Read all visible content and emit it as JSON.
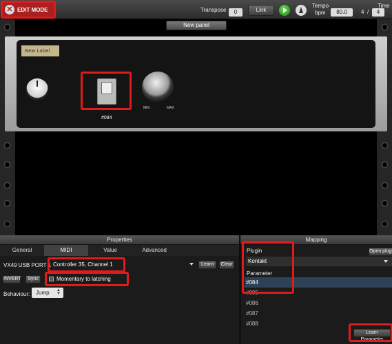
{
  "topbar": {
    "edit_mode": "EDIT MODE",
    "transpose_label": "Transpose",
    "transpose_value": "0",
    "link_label": "Link",
    "tempo_label": "Tempo",
    "bpm_label": "bpm",
    "tempo_value": "80.0",
    "time_label": "Time",
    "time_numerator": "4",
    "time_separator": "/",
    "time_denominator": "4"
  },
  "rack": {
    "new_panel_label": "New panel",
    "panel_label": "New Label",
    "switch_tag": "#084",
    "knob_min": "MIN",
    "knob_max": "MAX"
  },
  "properties": {
    "title": "Properties",
    "tabs": [
      "General",
      "MIDI",
      "Value",
      "Advanced"
    ],
    "active_tab": "MIDI",
    "port": "VX49 USB PORT 1",
    "controller": "Controller 35, Channel 1",
    "learn_label": "Learn",
    "clear_label": "Clear",
    "invert_label": "INVERT",
    "sync_label": "Sync",
    "momentary_label": "Momentary to latching",
    "behaviour_label": "Behaviour:",
    "behaviour_value": "Jump"
  },
  "mapping": {
    "title": "Mapping",
    "plugin_label": "Plugin",
    "open_plugin_label": "Open plugin",
    "plugin_value": "Kontakt",
    "parameter_label": "Parameter",
    "parameters": [
      "#084",
      "#085",
      "#086",
      "#087",
      "#088"
    ],
    "selected_parameter": "#084",
    "learn_parameter_label": "Learn Parameter"
  },
  "colors": {
    "edit_mode_bg": "#a82020",
    "annotation_red": "#e01b1b",
    "selected_row": "#2e4257"
  }
}
